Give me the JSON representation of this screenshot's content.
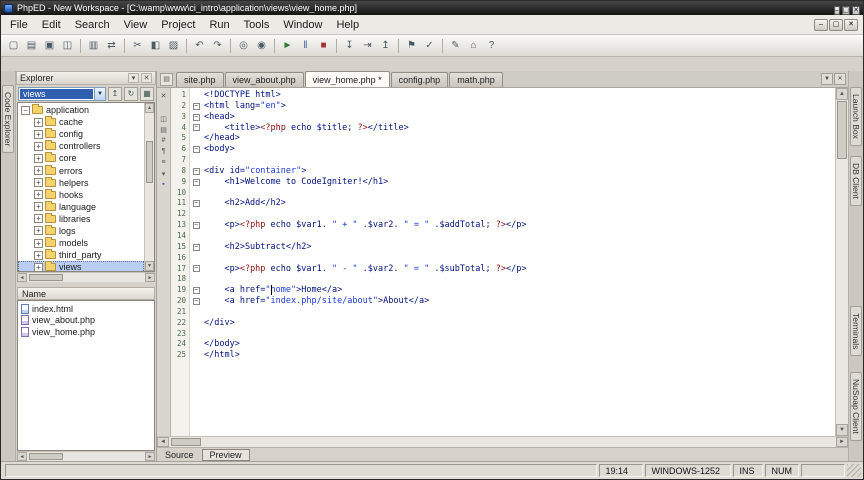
{
  "window": {
    "title": "PhpED - New Workspace - [C:\\wamp\\www\\ci_intro\\application\\views\\view_home.php]",
    "controls": [
      {
        "name": "minimize-button",
        "glyph": "–"
      },
      {
        "name": "maximize-button",
        "glyph": "▢"
      },
      {
        "name": "close-button",
        "glyph": "✕"
      }
    ]
  },
  "menu": {
    "items": [
      "File",
      "Edit",
      "Search",
      "View",
      "Project",
      "Run",
      "Tools",
      "Window",
      "Help"
    ],
    "mdi_controls": [
      {
        "name": "mdi-minimize-button",
        "glyph": "–"
      },
      {
        "name": "mdi-restore-button",
        "glyph": "▢"
      },
      {
        "name": "mdi-close-button",
        "glyph": "✕"
      }
    ]
  },
  "toolbar": {
    "icons": [
      {
        "name": "new-file-icon",
        "glyph": "▢"
      },
      {
        "name": "open-file-icon",
        "glyph": "▤"
      },
      {
        "name": "save-icon",
        "glyph": "▣"
      },
      {
        "name": "save-all-icon",
        "glyph": "◫"
      },
      {
        "sep": true
      },
      {
        "name": "print-icon",
        "glyph": "▥"
      },
      {
        "name": "sync-icon",
        "glyph": "⇄"
      },
      {
        "sep": true
      },
      {
        "name": "cut-icon",
        "glyph": "✂"
      },
      {
        "name": "copy-icon",
        "glyph": "◧"
      },
      {
        "name": "paste-icon",
        "glyph": "▨"
      },
      {
        "sep": true
      },
      {
        "name": "undo-icon",
        "glyph": "↶"
      },
      {
        "name": "redo-icon",
        "glyph": "↷"
      },
      {
        "sep": true
      },
      {
        "name": "find-icon",
        "glyph": "◎"
      },
      {
        "name": "replace-icon",
        "glyph": "◉"
      },
      {
        "sep": true
      },
      {
        "name": "run-icon",
        "glyph": "►",
        "color": "#2e7d32"
      },
      {
        "name": "pause-icon",
        "glyph": "‖",
        "color": "#355f9e"
      },
      {
        "name": "stop-icon",
        "glyph": "■",
        "color": "#a33333"
      },
      {
        "sep": true
      },
      {
        "name": "step-into-icon",
        "glyph": "↧"
      },
      {
        "name": "step-over-icon",
        "glyph": "⇥"
      },
      {
        "name": "step-out-icon",
        "glyph": "↥"
      },
      {
        "sep": true
      },
      {
        "name": "bookmark-icon",
        "glyph": "⚑"
      },
      {
        "name": "spell-check-icon",
        "glyph": "✓"
      },
      {
        "sep": true
      },
      {
        "name": "edit-icon",
        "glyph": "✎"
      },
      {
        "name": "home-icon",
        "glyph": "⌂"
      },
      {
        "name": "help-icon",
        "glyph": "?"
      }
    ]
  },
  "side_tabs": {
    "left": [
      "Code Explorer"
    ],
    "right": [
      "Launch Box",
      "DB Client",
      "Terminals",
      "NuSoap Client"
    ]
  },
  "explorer": {
    "title": "Explorer",
    "header_buttons": [
      {
        "name": "pin-icon",
        "glyph": "▾"
      },
      {
        "name": "close-panel-icon",
        "glyph": "✕"
      }
    ],
    "combo_value": "views",
    "combo_buttons": [
      {
        "name": "folder-up-icon",
        "glyph": "↥"
      },
      {
        "name": "refresh-icon",
        "glyph": "↻"
      },
      {
        "name": "filter-icon",
        "glyph": "▦"
      }
    ],
    "tree": [
      {
        "label": "application",
        "level": 0,
        "expand": "minus",
        "selected": false
      },
      {
        "label": "cache",
        "level": 1,
        "expand": "plus",
        "selected": false
      },
      {
        "label": "config",
        "level": 1,
        "expand": "plus",
        "selected": false
      },
      {
        "label": "controllers",
        "level": 1,
        "expand": "plus",
        "selected": false
      },
      {
        "label": "core",
        "level": 1,
        "expand": "plus",
        "selected": false
      },
      {
        "label": "errors",
        "level": 1,
        "expand": "plus",
        "selected": false
      },
      {
        "label": "helpers",
        "level": 1,
        "expand": "plus",
        "selected": false
      },
      {
        "label": "hooks",
        "level": 1,
        "expand": "plus",
        "selected": false
      },
      {
        "label": "language",
        "level": 1,
        "expand": "plus",
        "selected": false
      },
      {
        "label": "libraries",
        "level": 1,
        "expand": "plus",
        "selected": false
      },
      {
        "label": "logs",
        "level": 1,
        "expand": "plus",
        "selected": false
      },
      {
        "label": "models",
        "level": 1,
        "expand": "plus",
        "selected": false
      },
      {
        "label": "third_party",
        "level": 1,
        "expand": "plus",
        "selected": false
      },
      {
        "label": "views",
        "level": 1,
        "expand": "plus",
        "selected": true
      }
    ],
    "files_header": "Name",
    "files": [
      {
        "name": "index.html",
        "type": "html"
      },
      {
        "name": "view_about.php",
        "type": "php"
      },
      {
        "name": "view_home.php",
        "type": "php"
      }
    ]
  },
  "tabs": [
    {
      "label": "site.php",
      "active": false
    },
    {
      "label": "view_about.php",
      "active": false
    },
    {
      "label": "view_home.php *",
      "active": true
    },
    {
      "label": "config.php",
      "active": false
    },
    {
      "label": "math.php",
      "active": false
    }
  ],
  "editor": {
    "caret": {
      "line": 19,
      "col": 14
    },
    "gutter_icons": [
      {
        "name": "close-file-icon",
        "glyph": "✕"
      },
      {
        "name": "compare-icon",
        "glyph": "◫"
      },
      {
        "name": "bookmarks-icon",
        "glyph": "▤"
      },
      {
        "name": "line-numbers-icon",
        "glyph": "#"
      },
      {
        "name": "word-wrap-icon",
        "glyph": "¶"
      },
      {
        "name": "fold-all-icon",
        "glyph": "≡"
      },
      {
        "name": "highlight-icon",
        "glyph": "▾"
      },
      {
        "name": "breakpoint-icon",
        "glyph": "▪",
        "color": "#2653b4"
      }
    ],
    "lines": [
      {
        "n": 1,
        "text": "<!DOCTYPE html>",
        "fold": false
      },
      {
        "n": 2,
        "text": "<html lang=\"en\">",
        "fold": true
      },
      {
        "n": 3,
        "text": "<head>",
        "fold": true
      },
      {
        "n": 4,
        "text": "    <title><?php echo $title; ?></title>",
        "fold": true
      },
      {
        "n": 5,
        "text": "</head>",
        "fold": false
      },
      {
        "n": 6,
        "text": "<body>",
        "fold": true
      },
      {
        "n": 7,
        "text": "",
        "fold": false
      },
      {
        "n": 8,
        "text": "<div id=\"container\">",
        "fold": true
      },
      {
        "n": 9,
        "text": "    <h1>Welcome to CodeIgniter!</h1>",
        "fold": true
      },
      {
        "n": 10,
        "text": "",
        "fold": false
      },
      {
        "n": 11,
        "text": "    <h2>Add</h2>",
        "fold": true
      },
      {
        "n": 12,
        "text": "",
        "fold": false
      },
      {
        "n": 13,
        "text": "    <p><?php echo $var1. \" + \" .$var2. \" = \" .$addTotal; ?></p>",
        "fold": true
      },
      {
        "n": 14,
        "text": "",
        "fold": false
      },
      {
        "n": 15,
        "text": "    <h2>Subtract</h2>",
        "fold": true
      },
      {
        "n": 16,
        "text": "",
        "fold": false
      },
      {
        "n": 17,
        "text": "    <p><?php echo $var1. \" - \" .$var2. \" = \" .$subTotal; ?></p>",
        "fold": true
      },
      {
        "n": 18,
        "text": "",
        "fold": false
      },
      {
        "n": 19,
        "text": "    <a href=\"home\">Home</a>",
        "fold": true
      },
      {
        "n": 20,
        "text": "    <a href=\"index.php/site/about\">About</a>",
        "fold": true
      },
      {
        "n": 21,
        "text": "",
        "fold": false
      },
      {
        "n": 22,
        "text": "</div>",
        "fold": false
      },
      {
        "n": 23,
        "text": "",
        "fold": false
      },
      {
        "n": 24,
        "text": "</body>",
        "fold": false
      },
      {
        "n": 25,
        "text": "</html>",
        "fold": false
      }
    ]
  },
  "bottom_tabs": {
    "source": "Source",
    "preview": "Preview"
  },
  "status": {
    "cursor": "19:14",
    "encoding": "WINDOWS-1252",
    "insert_mode": "INS",
    "num_lock": "NUM"
  }
}
